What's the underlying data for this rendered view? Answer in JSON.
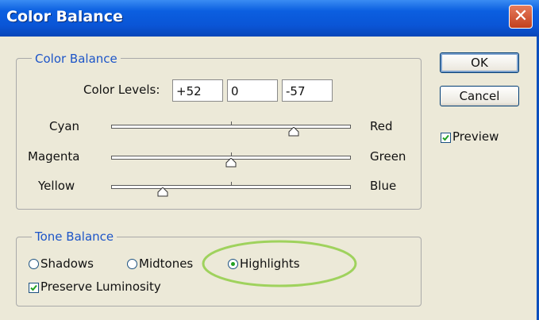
{
  "window": {
    "title": "Color Balance",
    "close_label": "✕"
  },
  "color_balance": {
    "legend": "Color Balance",
    "levels_label": "Color Levels:",
    "levels": [
      "+52",
      "0",
      "-57"
    ],
    "sliders": [
      {
        "left": "Cyan",
        "right": "Red",
        "value": 52
      },
      {
        "left": "Magenta",
        "right": "Green",
        "value": 0
      },
      {
        "left": "Yellow",
        "right": "Blue",
        "value": -57
      }
    ]
  },
  "tone_balance": {
    "legend": "Tone Balance",
    "options": [
      "Shadows",
      "Midtones",
      "Highlights"
    ],
    "selected": "Highlights",
    "preserve_label": "Preserve Luminosity",
    "preserve_checked": true
  },
  "buttons": {
    "ok": "OK",
    "cancel": "Cancel"
  },
  "preview": {
    "label": "Preview",
    "checked": true
  },
  "colors": {
    "title_bar": "#0b5fe0",
    "legend_text": "#1d55c8",
    "highlight_ellipse": "#9fd25d",
    "check_mark": "#21a121"
  }
}
